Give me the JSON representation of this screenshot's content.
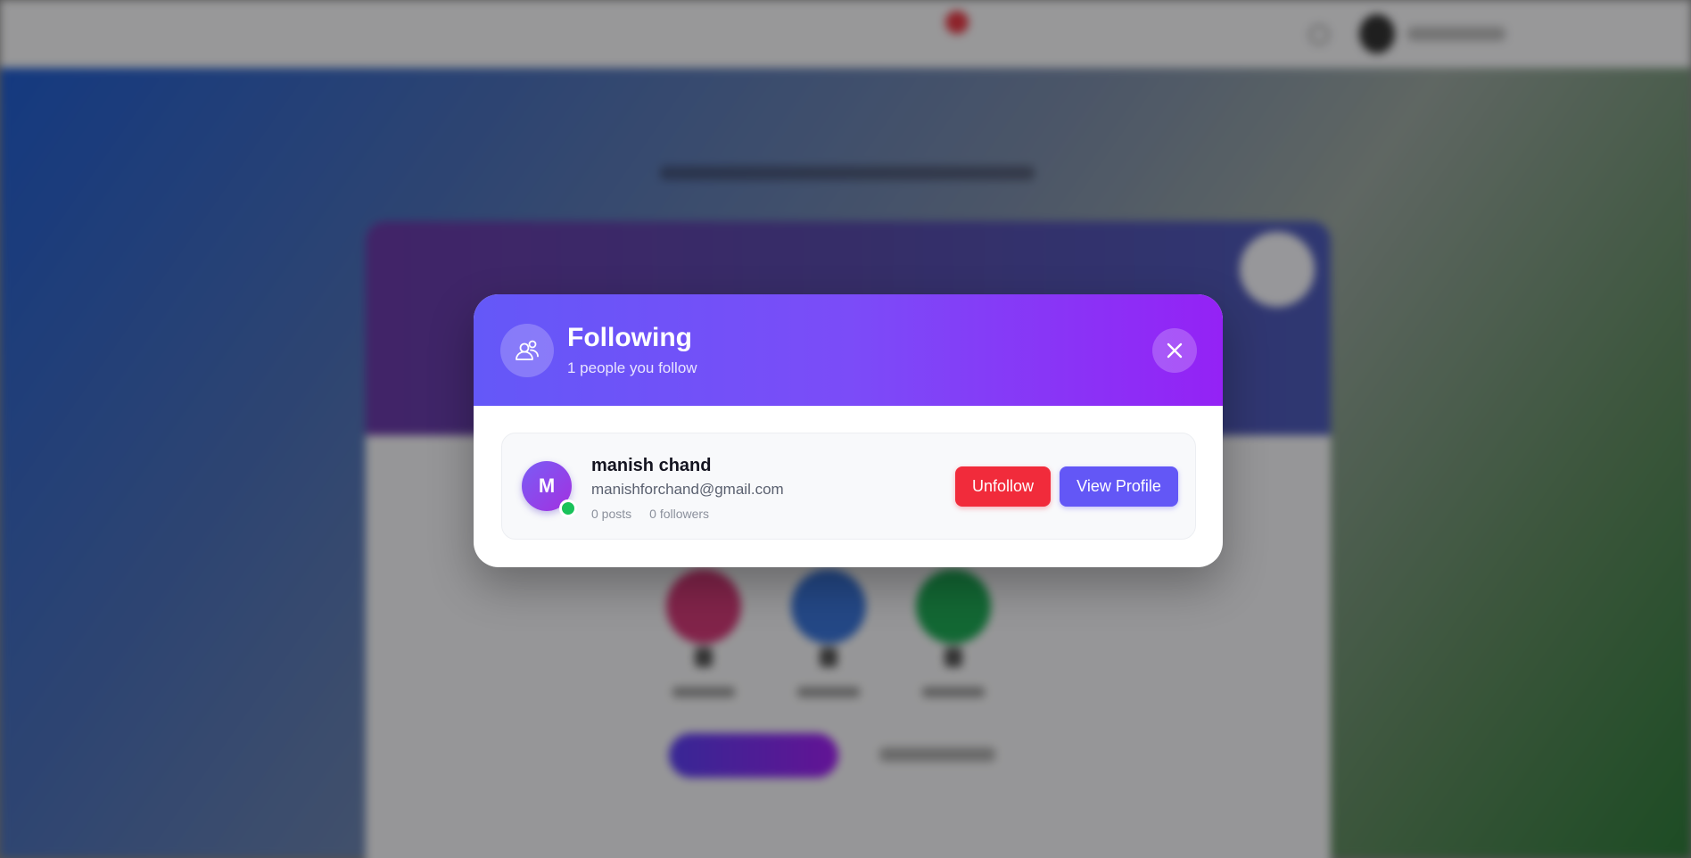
{
  "modal": {
    "title": "Following",
    "subtitle": "1 people you follow",
    "header_icon": "users-icon",
    "close_icon": "close-icon"
  },
  "following": [
    {
      "avatar_initial": "M",
      "name": "manish chand",
      "email": "manishforchand@gmail.com",
      "posts": "0 posts",
      "followers": "0 followers",
      "online": true,
      "unfollow_label": "Unfollow",
      "view_profile_label": "View Profile"
    }
  ],
  "colors": {
    "header_gradient_start": "#6458f8",
    "header_gradient_end": "#9422f5",
    "unfollow": "#f12b3b",
    "view_profile": "#6357f6",
    "online": "#19c25a"
  }
}
